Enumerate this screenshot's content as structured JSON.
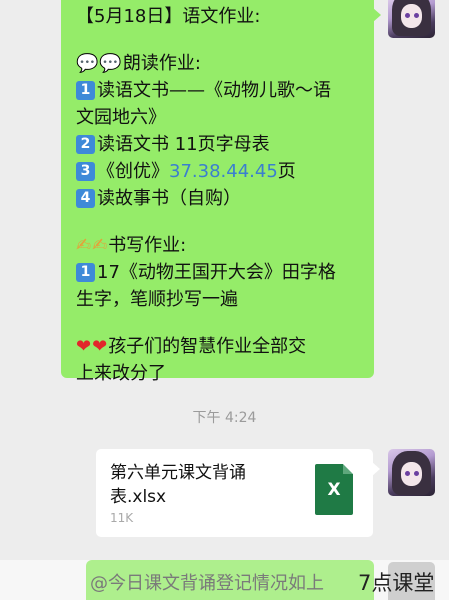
{
  "message": {
    "title": "【5月18日】语文作业:",
    "reading_header": "朗读作业:",
    "reading_items": [
      {
        "num": "1",
        "text_a": "读语文书——《动物儿歌～语",
        "text_b": "文园地六》"
      },
      {
        "num": "2",
        "text": "读语文书 11页字母表"
      },
      {
        "num": "3",
        "prefix": "《创优》",
        "link": "37.38.44.45",
        "suffix": "页"
      },
      {
        "num": "4",
        "text": "读故事书（自购）"
      }
    ],
    "writing_header": "书写作业:",
    "writing_items": [
      {
        "num": "1",
        "text_a": "17《动物王国开大会》田字格",
        "text_b": "生字，笔顺抄写一遍"
      }
    ],
    "closing_a": "孩子们的智慧作业全部交",
    "closing_b": "上来改分了"
  },
  "timestamp": "下午 4:24",
  "file": {
    "name_a": "第六单元课文背诵",
    "name_b": "表.xlsx",
    "size": "11K",
    "icon_letter": "X"
  },
  "partial_message": "@今日课文背诵登记情况如上",
  "watermark": "7点课堂",
  "icons": {
    "speech": "speech-bubble-icon",
    "writing": "writing-hand-icon",
    "heart": "red-heart-icon",
    "file": "excel-file-icon"
  },
  "colors": {
    "bubble_green": "#95ec69",
    "background": "#ededed",
    "keycap_blue": "#3e8ad8",
    "link_blue": "#3a7fcf",
    "excel_green": "#1f7a45"
  }
}
